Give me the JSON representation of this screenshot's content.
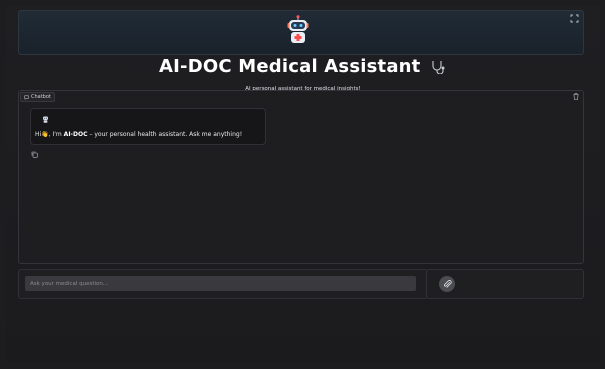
{
  "header": {
    "title": "AI-DOC Medical Assistant",
    "subtitle": "AI personal assistant for medical insights!",
    "logo_icon": "robot-doctor-icon",
    "title_icon": "stethoscope-icon"
  },
  "chatbot": {
    "label": "Chatbot",
    "messages": [
      {
        "role": "assistant",
        "prefix": "Hi",
        "emoji": "👋",
        "mid": ", I'm ",
        "bold": "AI-DOC",
        "suffix": " – your personal health assistant. Ask me anything!"
      }
    ]
  },
  "input": {
    "value": "",
    "placeholder": "Ask your medical question..."
  },
  "colors": {
    "background": "#1d1d20",
    "banner": "#202b36",
    "input": "#3a3a3e",
    "attach_button": "#4b4d52"
  }
}
